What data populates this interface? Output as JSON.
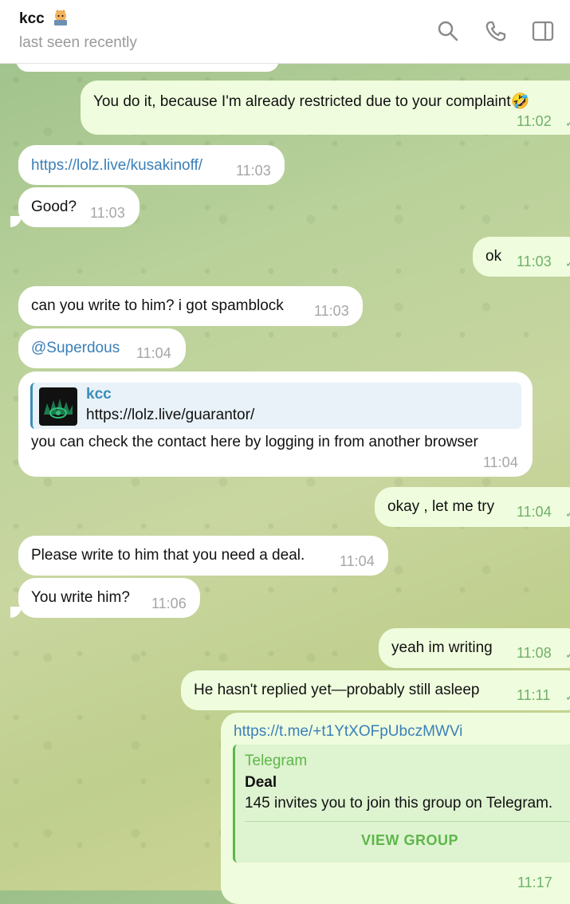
{
  "header": {
    "title": "kcc",
    "status": "last seen recently"
  },
  "messages": [
    {
      "dir": "out",
      "text": "You do it, because I'm already restricted due to your complaint🤣",
      "time": "11:02"
    },
    {
      "dir": "in",
      "text": "https://lolz.live/kusakinoff/",
      "time": "11:03"
    },
    {
      "dir": "in",
      "text": "Good?",
      "time": "11:03"
    },
    {
      "dir": "out",
      "text": "ok",
      "time": "11:03"
    },
    {
      "dir": "in",
      "text": "can you write to him? i got spamblock",
      "time": "11:03"
    },
    {
      "dir": "in",
      "text": "@Superdous",
      "time": "11:04"
    },
    {
      "dir": "in",
      "reply": {
        "author": "kcc",
        "text": "https://lolz.live/guarantor/"
      },
      "text": "you can check the contact here by logging in from another browser",
      "time": "11:04"
    },
    {
      "dir": "out",
      "text": "okay , let me try",
      "time": "11:04"
    },
    {
      "dir": "in",
      "text": "Please write to him that you need a deal.",
      "time": "11:04"
    },
    {
      "dir": "in",
      "text": "You write him?",
      "time": "11:06"
    },
    {
      "dir": "out",
      "text": "yeah im writing",
      "time": "11:08"
    },
    {
      "dir": "out",
      "text": "He hasn't replied yet—probably still asleep",
      "time": "11:11"
    },
    {
      "dir": "out",
      "text": "https://t.me/+t1YtXOFpUbczMWVi",
      "preview": {
        "site": "Telegram",
        "title": "Deal",
        "description": "145 invites you to join this group on Telegram.",
        "button": "VIEW GROUP"
      },
      "time": "11:17"
    }
  ],
  "colors": {
    "accent": "#3a8fb8",
    "outgoing": "#effdde",
    "link": "#3a7fb8",
    "green": "#5fb64b"
  }
}
